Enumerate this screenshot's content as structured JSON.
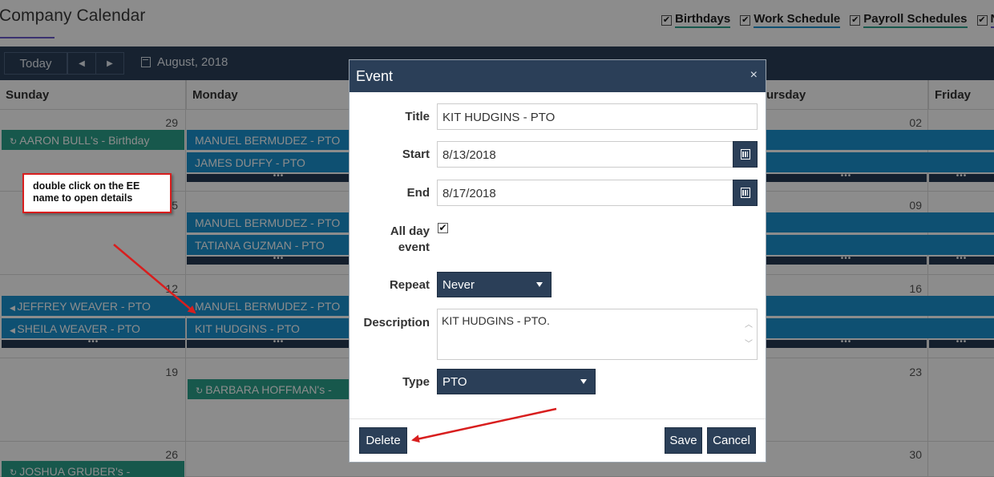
{
  "page": {
    "title": "Company Calendar"
  },
  "filters": [
    {
      "label": "Birthdays",
      "checked": true,
      "color": "#2aa08a"
    },
    {
      "label": "Work Schedule",
      "checked": true,
      "color": "#1a93d0"
    },
    {
      "label": "Payroll Schedules",
      "checked": true,
      "color": "#2aa08a"
    },
    {
      "label": "Ne",
      "checked": true,
      "color": "#6a5acd"
    }
  ],
  "toolbar": {
    "today_label": "Today",
    "prev_icon": "◀",
    "next_icon": "▶",
    "month_label": "August, 2018"
  },
  "days": [
    "Sunday",
    "Monday",
    "",
    "",
    "ursday",
    "Friday"
  ],
  "weeks": [
    {
      "nums": [
        "29",
        "",
        "",
        "",
        "02"
      ]
    },
    {
      "nums": [
        "5",
        "",
        "",
        "",
        "09"
      ]
    },
    {
      "nums": [
        "12",
        "",
        "",
        "",
        "16"
      ]
    },
    {
      "nums": [
        "19",
        "",
        "",
        "",
        "23"
      ]
    },
    {
      "nums": [
        "26",
        "",
        "",
        "",
        "30"
      ]
    }
  ],
  "events": {
    "aaron": "AARON BULL's - Birthday",
    "manuel1": "MANUEL BERMUDEZ - PTO",
    "james": "JAMES DUFFY - PTO",
    "manuel2": "MANUEL BERMUDEZ - PTO",
    "tatiana": "TATIANA GUZMAN - PTO",
    "jeffrey": "JEFFREY WEAVER - PTO",
    "sheila": "SHEILA WEAVER - PTO",
    "manuel3": "MANUEL BERMUDEZ - PTO",
    "kit": "KIT HUDGINS - PTO",
    "barbara": "BARBARA HOFFMAN's -",
    "joshua": "JOSHUA GRUBER's -",
    "more": "•••"
  },
  "modal": {
    "title": "Event",
    "close_icon": "×",
    "labels": {
      "title": "Title",
      "start": "Start",
      "end": "End",
      "allday_1": "All day",
      "allday_2": "event",
      "repeat": "Repeat",
      "description": "Description",
      "type": "Type"
    },
    "values": {
      "title": "KIT HUDGINS - PTO",
      "start": "8/13/2018",
      "end": "8/17/2018",
      "allday": "✔",
      "repeat": "Never",
      "description": "KIT HUDGINS - PTO.",
      "type": "PTO"
    },
    "buttons": {
      "delete": "Delete",
      "save": "Save",
      "cancel": "Cancel"
    }
  },
  "annotation": {
    "line1": "double click on the EE",
    "line2": "name to open details"
  },
  "colors": {
    "primary": "#2b3f58",
    "event_blue": "#1a93d0",
    "event_green": "#2aa08a",
    "annotation_red": "#d81e1e"
  }
}
